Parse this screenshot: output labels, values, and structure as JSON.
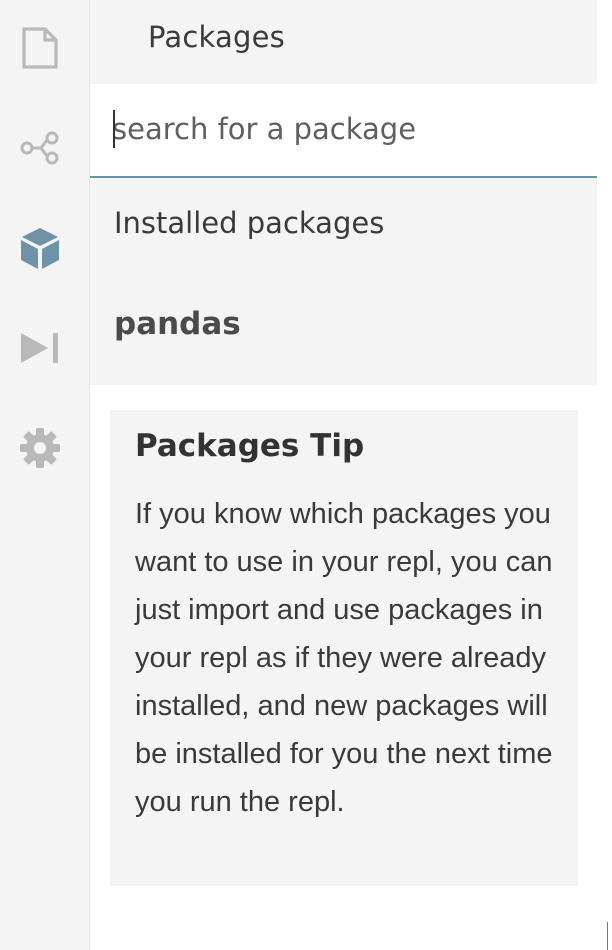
{
  "sidebar": {
    "items": [
      {
        "name": "files",
        "icon": "file-icon"
      },
      {
        "name": "version-control",
        "icon": "share-nodes-icon"
      },
      {
        "name": "packages",
        "icon": "package-cube-icon",
        "active": true
      },
      {
        "name": "debugger",
        "icon": "step-forward-icon"
      },
      {
        "name": "settings",
        "icon": "gear-icon"
      }
    ],
    "icon_color": "#b9b9b9",
    "active_icon_color": "#6f92a8"
  },
  "packages_panel": {
    "title": "Packages",
    "search": {
      "placeholder": "search for a package",
      "value": ""
    },
    "installed_label": "Installed packages",
    "installed": [
      "pandas"
    ],
    "tip": {
      "title": "Packages Tip",
      "body": "If you know which packages you want to use in your repl, you can just import and use packages in your repl as if they were already installed, and new packages will be installed for you the next time you run the repl."
    }
  }
}
